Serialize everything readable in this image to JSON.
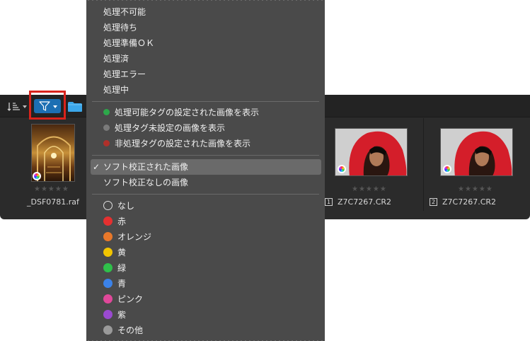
{
  "menu": {
    "status_items": [
      {
        "label": "処理不可能"
      },
      {
        "label": "処理待ち"
      },
      {
        "label": "処理準備ＯＫ"
      },
      {
        "label": "処理済"
      },
      {
        "label": "処理エラー"
      },
      {
        "label": "処理中"
      }
    ],
    "tag_items": [
      {
        "label": "処理可能タグの設定された画像を表示",
        "color": "#2da84a"
      },
      {
        "label": "処理タグ未設定の画像を表示",
        "color": "#7a7a7a"
      },
      {
        "label": "非処理タグの設定された画像を表示",
        "color": "#b0302a"
      }
    ],
    "softproof_items": [
      {
        "label": "ソフト校正された画像",
        "checked": true
      },
      {
        "label": "ソフト校正なしの画像",
        "checked": false
      }
    ],
    "check_mark": "✓",
    "color_items": [
      {
        "label": "なし",
        "color": "none"
      },
      {
        "label": "赤",
        "color": "#e63030"
      },
      {
        "label": "オレンジ",
        "color": "#e8782a"
      },
      {
        "label": "黄",
        "color": "#f2c500"
      },
      {
        "label": "緑",
        "color": "#2fc04a"
      },
      {
        "label": "青",
        "color": "#3b82e8"
      },
      {
        "label": "ピンク",
        "color": "#e0489a"
      },
      {
        "label": "紫",
        "color": "#9a4ad0"
      },
      {
        "label": "その他",
        "color": "#9a9a9a"
      }
    ]
  },
  "toolbar": {
    "sort_icon": "sort-icon",
    "filter_icon": "filter-icon",
    "folder_icon": "folder-icon",
    "filter_active_color": "#1c6fb3"
  },
  "thumbnails": [
    {
      "filename": "_DSF0781.raf",
      "rating": "★★★★★",
      "badge": ""
    },
    {
      "filename": "Z7C7267.CR2",
      "rating": "★★★★★",
      "badge": "1"
    },
    {
      "filename": "Z7C7267.CR2",
      "rating": "★★★★★",
      "badge": "2"
    }
  ]
}
